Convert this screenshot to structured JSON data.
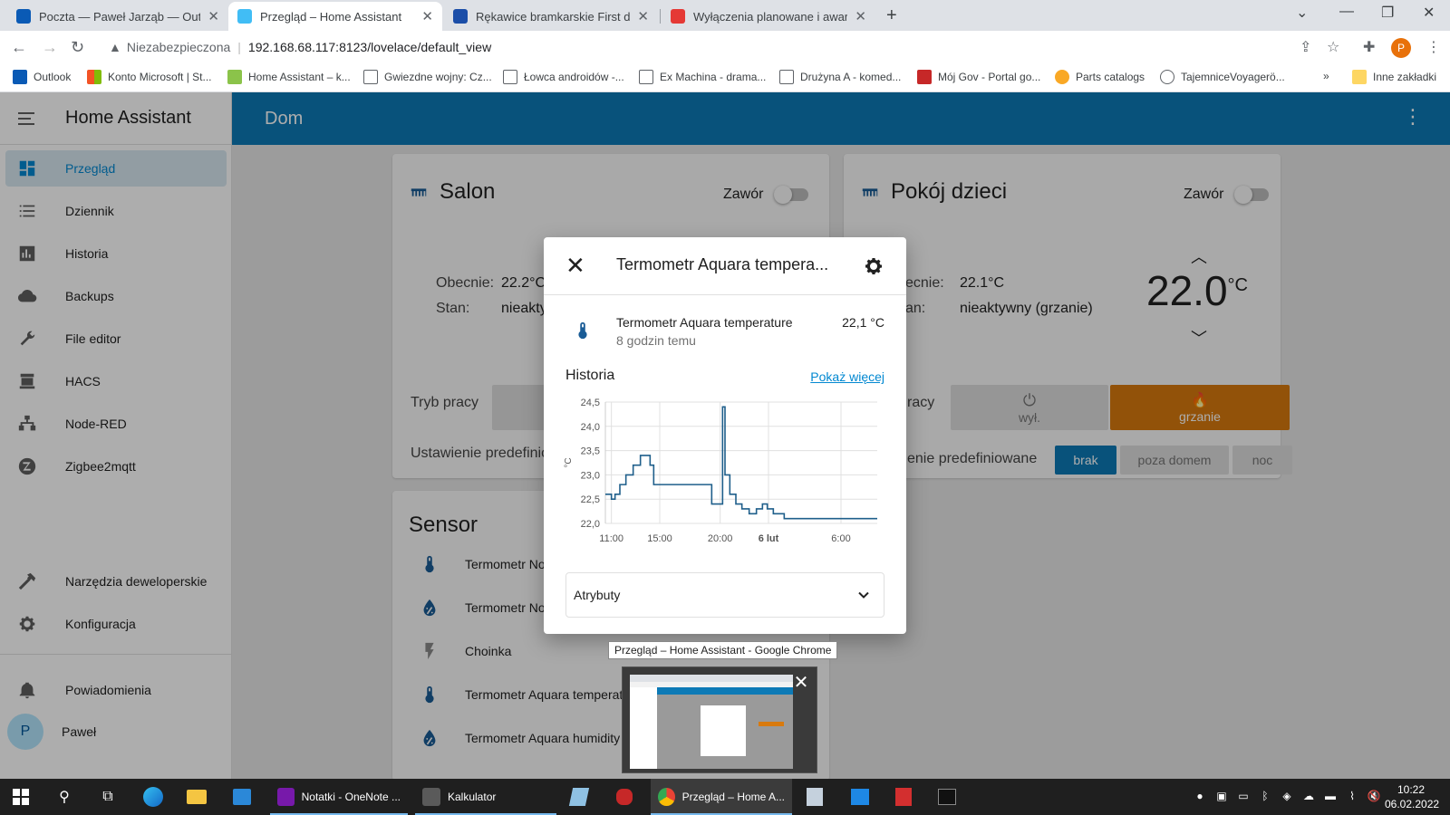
{
  "browser": {
    "tabs": [
      {
        "title": "Poczta — Paweł Jarząb — Outlo",
        "color": "#0a5ab5"
      },
      {
        "title": "Przegląd – Home Assistant",
        "color": "#41bdf5"
      },
      {
        "title": "Rękawice bramkarskie First do pił",
        "color": "#1b4ea8"
      },
      {
        "title": "Wyłączenia planowane i awarie |",
        "color": "#e53935"
      }
    ],
    "address": {
      "insecure_label": "Niezabezpieczona",
      "url": "192.168.68.117:8123/lovelace/default_view"
    },
    "profile_initial": "P",
    "bookmarks": [
      "Outlook",
      "Konto Microsoft | St...",
      "Home Assistant – k...",
      "Gwiezdne wojny: Cz...",
      "Łowca androidów -...",
      "Ex Machina - drama...",
      "Drużyna A - komed...",
      "Mój Gov - Portal go...",
      "Parts catalogs",
      "TajemniceVoyagerö...",
      "Inne zakładki"
    ]
  },
  "sidebar": {
    "title": "Home Assistant",
    "items": [
      {
        "label": "Przegląd",
        "icon": "dashboard-icon"
      },
      {
        "label": "Dziennik",
        "icon": "logbook-icon"
      },
      {
        "label": "Historia",
        "icon": "history-icon"
      },
      {
        "label": "Backups",
        "icon": "cloud-icon"
      },
      {
        "label": "File editor",
        "icon": "wrench-icon"
      },
      {
        "label": "HACS",
        "icon": "hacs-icon"
      },
      {
        "label": "Node-RED",
        "icon": "sitemap-icon"
      },
      {
        "label": "Zigbee2mqtt",
        "icon": "zigbee-icon"
      }
    ],
    "bottom_items": [
      {
        "label": "Narzędzia deweloperskie",
        "icon": "hammer-icon"
      },
      {
        "label": "Konfiguracja",
        "icon": "gear-icon"
      }
    ],
    "notifications_label": "Powiadomienia",
    "user_name": "Paweł",
    "user_initial": "P"
  },
  "header": {
    "view_title": "Dom"
  },
  "cards": {
    "salon": {
      "title": "Salon",
      "valve_label": "Zawór",
      "current_label": "Obecnie:",
      "current_value": "22.2°C",
      "state_label": "Stan:",
      "state_value": "nieakty",
      "mode_label": "Tryb pracy",
      "preset_label": "Ustawienie predefinio"
    },
    "pokoj": {
      "title": "Pokój dzieci",
      "valve_label": "Zawór",
      "current_label": "ecnie:",
      "current_value": "22.1°C",
      "state_label": "an:",
      "state_value": "nieaktywny (grzanie)",
      "target_temp": "22.0",
      "target_unit": "°C",
      "mode_label": "racy",
      "mode_off": "wył.",
      "mode_heat": "grzanie",
      "preset_label": "enie predefiniowane",
      "presets": [
        "brak",
        "poza domem",
        "noc"
      ]
    },
    "sensor": {
      "title": "Sensor",
      "rows": [
        {
          "name": "Termometr Nou",
          "icon": "thermometer-icon"
        },
        {
          "name": "Termometr Nou",
          "icon": "humidity-icon"
        },
        {
          "name": "Choinka",
          "icon": "flash-icon"
        },
        {
          "name": "Termometr Aquara temperatu",
          "icon": "thermometer-icon"
        },
        {
          "name": "Termometr Aquara humidity",
          "icon": "humidity-icon"
        }
      ]
    }
  },
  "dialog": {
    "title": "Termometr Aquara tempera...",
    "entity_name": "Termometr Aquara temperature",
    "entity_time": "8 godzin temu",
    "entity_value": "22,1 °C",
    "history_label": "Historia",
    "more_label": "Pokaż więcej",
    "attributes_label": "Atrybuty"
  },
  "chart_data": {
    "type": "line",
    "title": "",
    "xlabel": "",
    "ylabel": "°C",
    "ylim": [
      22.0,
      24.5
    ],
    "yticks": [
      "22,0",
      "22,5",
      "23,0",
      "23,5",
      "24,0",
      "24,5"
    ],
    "xticks": [
      {
        "label": "11:00",
        "h": 11
      },
      {
        "label": "15:00",
        "h": 15
      },
      {
        "label": "20:00",
        "h": 20
      },
      {
        "label": "6 lut",
        "h": 24
      },
      {
        "label": "6:00",
        "h": 30
      }
    ],
    "xlim": [
      10.5,
      33
    ],
    "series": [
      {
        "name": "",
        "color": "#1f5f8b",
        "points": [
          [
            10.5,
            22.6
          ],
          [
            11.0,
            22.5
          ],
          [
            11.3,
            22.6
          ],
          [
            11.7,
            22.8
          ],
          [
            12.2,
            23.0
          ],
          [
            12.8,
            23.2
          ],
          [
            13.4,
            23.4
          ],
          [
            14.2,
            23.2
          ],
          [
            14.5,
            22.8
          ],
          [
            15.5,
            22.8
          ],
          [
            17.0,
            22.8
          ],
          [
            19.0,
            22.8
          ],
          [
            19.3,
            22.4
          ],
          [
            19.8,
            22.4
          ],
          [
            20.2,
            24.4
          ],
          [
            20.4,
            23.0
          ],
          [
            20.8,
            22.6
          ],
          [
            21.3,
            22.4
          ],
          [
            21.8,
            22.3
          ],
          [
            22.4,
            22.2
          ],
          [
            23.0,
            22.3
          ],
          [
            23.5,
            22.4
          ],
          [
            23.9,
            22.3
          ],
          [
            24.4,
            22.2
          ],
          [
            25.3,
            22.1
          ],
          [
            33.0,
            22.1
          ]
        ]
      }
    ]
  },
  "tooltip": "Przegląd – Home Assistant - Google Chrome",
  "taskbar": {
    "apps": [
      {
        "label": "Notatki - OneNote ...",
        "color": "#7719aa"
      },
      {
        "label": "Kalkulator",
        "color": "#4a4a4a"
      },
      {
        "label": "Przegląd – Home A...",
        "color": "#4285f4"
      }
    ],
    "time": "10:22",
    "date": "06.02.2022"
  },
  "colors": {
    "accent": "#0d7ab6",
    "heating": "#d87a0e",
    "preset_active": "#0d7ab6"
  }
}
